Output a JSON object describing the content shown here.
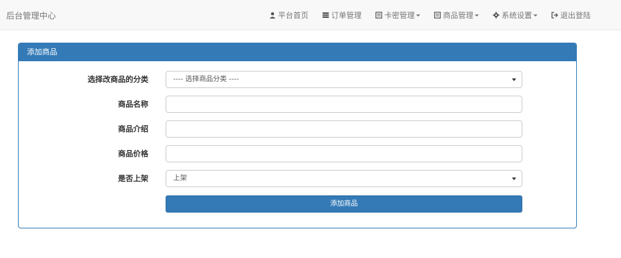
{
  "app": {
    "brand": "后台管理中心"
  },
  "nav": {
    "items": [
      {
        "label": "平台首页",
        "icon": "user-icon",
        "dropdown": false
      },
      {
        "label": "订单管理",
        "icon": "list-icon",
        "dropdown": false
      },
      {
        "label": "卡密管理",
        "icon": "card-icon",
        "dropdown": true
      },
      {
        "label": "商品管理",
        "icon": "card-icon",
        "dropdown": true
      },
      {
        "label": "系统设置",
        "icon": "gear-icon",
        "dropdown": true
      },
      {
        "label": "退出登陆",
        "icon": "logout-icon",
        "dropdown": false
      }
    ]
  },
  "panel": {
    "title": "添加商品",
    "fields": {
      "category": {
        "label": "选择改商品的分类",
        "value": "---- 选择商品分类 ----"
      },
      "name": {
        "label": "商品名称",
        "value": ""
      },
      "intro": {
        "label": "商品介绍",
        "value": ""
      },
      "price": {
        "label": "商品价格",
        "value": ""
      },
      "onshelf": {
        "label": "是否上架",
        "value": "上架"
      }
    },
    "submit_label": "添加商品"
  },
  "colors": {
    "primary": "#337ab7",
    "navbar_bg": "#f8f8f8",
    "nav_text": "#777777"
  }
}
